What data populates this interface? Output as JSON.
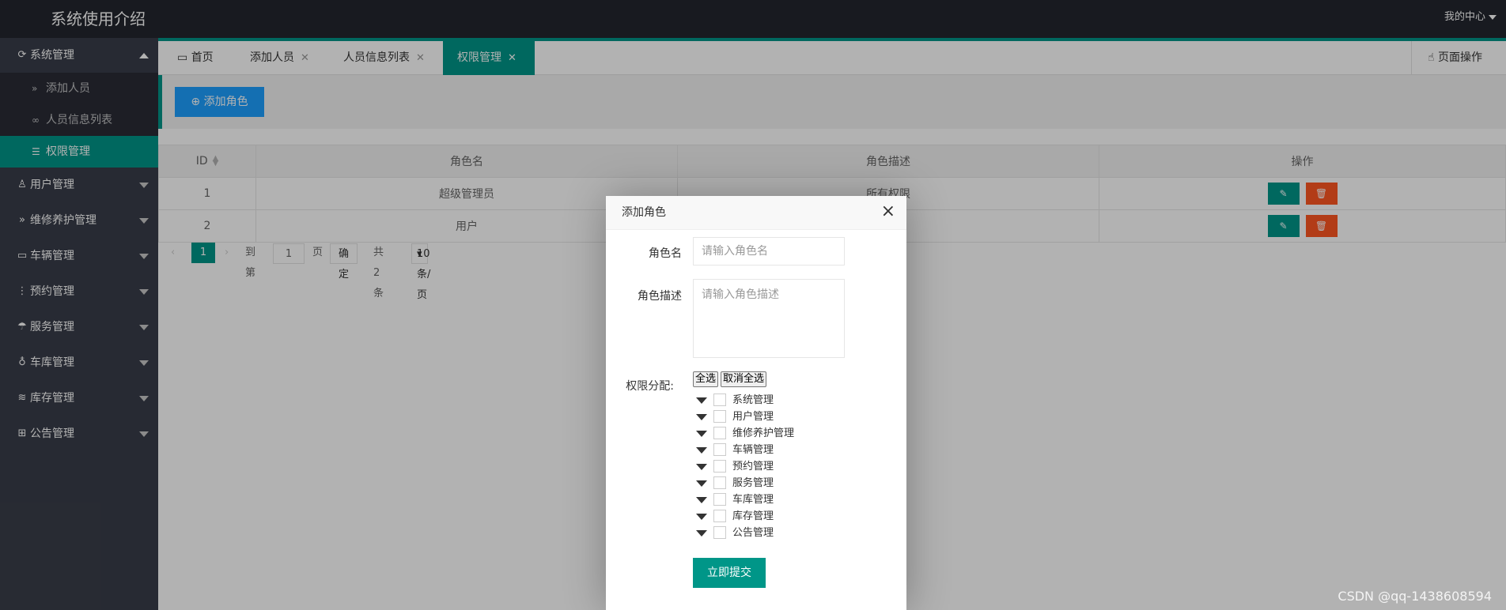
{
  "header": {
    "logo": "系统使用介绍",
    "user_menu": "我的中心"
  },
  "sidebar": {
    "items": [
      {
        "label": "系统管理",
        "icon": "circle-arrow-icon",
        "expanded": true
      },
      {
        "label": "用户管理",
        "icon": "user-icon"
      },
      {
        "label": "维修养护管理",
        "icon": "double-chevron-icon"
      },
      {
        "label": "车辆管理",
        "icon": "card-icon"
      },
      {
        "label": "预约管理",
        "icon": "vertical-dots-icon"
      },
      {
        "label": "服务管理",
        "icon": "umbrella-icon"
      },
      {
        "label": "车库管理",
        "icon": "drop-icon"
      },
      {
        "label": "库存管理",
        "icon": "stack-icon"
      },
      {
        "label": "公告管理",
        "icon": "book-icon"
      }
    ],
    "sub_items": [
      {
        "label": "添加人员",
        "icon": "double-chevron-icon"
      },
      {
        "label": "人员信息列表",
        "icon": "link-icon"
      },
      {
        "label": "权限管理",
        "icon": "list-icon",
        "active": true
      }
    ]
  },
  "tabs": [
    {
      "label": "首页",
      "icon": "monitor-icon"
    },
    {
      "label": "添加人员"
    },
    {
      "label": "人员信息列表"
    },
    {
      "label": "权限管理",
      "active": true
    }
  ],
  "page_ops": "页面操作",
  "toolbar": {
    "add_role": "添加角色"
  },
  "table": {
    "columns": [
      "ID",
      "角色名",
      "角色描述",
      "操作"
    ],
    "rows": [
      {
        "id": "1",
        "name": "超级管理员",
        "desc": "所有权限"
      },
      {
        "id": "2",
        "name": "用户",
        "desc": ""
      }
    ]
  },
  "pager": {
    "current": "1",
    "goto_label": "到第",
    "goto_value": "1",
    "page_unit": "页",
    "confirm": "确定",
    "total": "共 2 条",
    "per_page": "10 条/页"
  },
  "modal": {
    "title": "添加角色",
    "name_label": "角色名",
    "name_placeholder": "请输入角色名",
    "desc_label": "角色描述",
    "desc_placeholder": "请输入角色描述",
    "perm_label": "权限分配:",
    "select_all": "全选",
    "deselect_all": "取消全选",
    "permissions": [
      "系统管理",
      "用户管理",
      "维修养护管理",
      "车辆管理",
      "预约管理",
      "服务管理",
      "车库管理",
      "库存管理",
      "公告管理"
    ],
    "submit": "立即提交"
  },
  "watermark": "CSDN @qq-1438608594",
  "colors": {
    "accent": "#009688",
    "primary_button": "#1e9fff",
    "danger": "#ff5722",
    "sidebar": "#393d49",
    "header": "#23262e"
  }
}
